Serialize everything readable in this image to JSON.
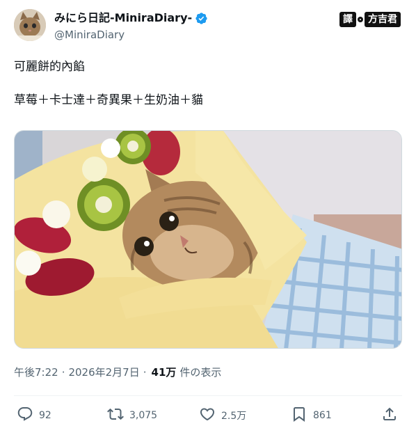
{
  "author": {
    "display_name": "みにら日記-MiniraDiary-",
    "handle": "@MiniraDiary",
    "verified": true
  },
  "watermark": {
    "left": "譯",
    "right": "方吉君"
  },
  "tweet": {
    "text": "可麗餅的內餡\n\n草莓＋卡士達＋奇異果＋生奶油＋貓"
  },
  "meta": {
    "time": "午後7:22",
    "separator": "·",
    "date": "2026年2月7日",
    "views": "41万",
    "views_label": "件の表示"
  },
  "actions": {
    "reply_count": "92",
    "retweet_count": "3,075",
    "like_count": "2.5万",
    "bookmark_count": "861"
  },
  "colors": {
    "text": "#0f1419",
    "secondary": "#536471",
    "verified": "#1d9bf0",
    "divider": "#eff3f4"
  }
}
